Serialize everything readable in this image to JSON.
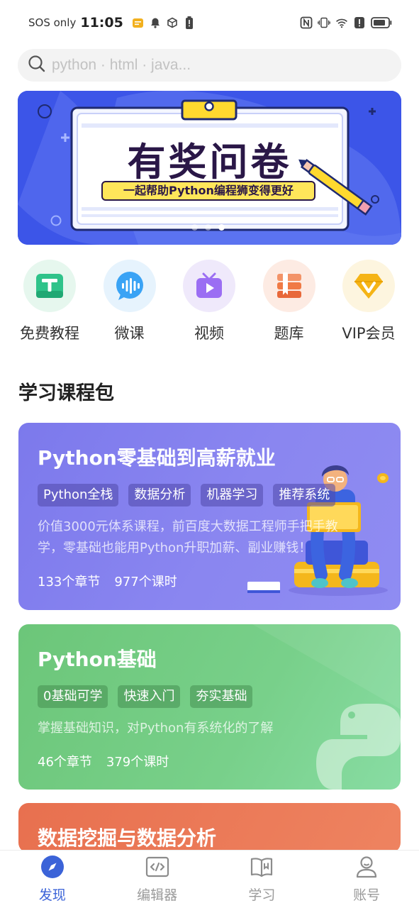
{
  "status_bar": {
    "carrier": "SOS only",
    "time": "11:05",
    "left_icons": [
      "notes-icon",
      "bell-icon",
      "box-icon",
      "battery-alert-icon"
    ],
    "right_icons": [
      "nfc-icon",
      "vibrate-icon",
      "wifi-icon",
      "alert-icon",
      "battery-icon"
    ]
  },
  "search": {
    "placeholder": "python · html · java..."
  },
  "banner": {
    "title": "有奖问卷",
    "subtitle": "一起帮助Python编程狮变得更好",
    "active_slide": 3,
    "slide_count": 3
  },
  "categories": [
    {
      "label": "免费教程",
      "icon": "book-t-icon",
      "color": "#2fc38a",
      "bg": "#e6f7ee"
    },
    {
      "label": "微课",
      "icon": "audio-bubble-icon",
      "color": "#3aa3f5",
      "bg": "#e6f3fd"
    },
    {
      "label": "视频",
      "icon": "tv-play-icon",
      "color": "#9b6ef3",
      "bg": "#efe9fb"
    },
    {
      "label": "题库",
      "icon": "books-icon",
      "color": "#f07a45",
      "bg": "#fdebe3"
    },
    {
      "label": "VIP会员",
      "icon": "diamond-v-icon",
      "color": "#f5b416",
      "bg": "#fdf5df"
    }
  ],
  "section_title": "学习课程包",
  "courses": [
    {
      "title": "Python零基础到高薪就业",
      "tags": [
        "Python全栈",
        "数据分析",
        "机器学习",
        "推荐系统"
      ],
      "desc_line1": "价值3000元体系课程，前百度大数据工程师手把手教",
      "desc_line2": "学，零基础也能用Python升职加薪、副业赚钱！",
      "chapters": "133个章节",
      "lessons": "977个课时"
    },
    {
      "title": "Python基础",
      "tags": [
        "0基础可学",
        "快速入门",
        "夯实基础"
      ],
      "desc_line1": "掌握基础知识，对Python有系统化的了解",
      "chapters": "46个章节",
      "lessons": "379个课时"
    },
    {
      "title": "数据挖掘与数据分析"
    }
  ],
  "bottom_nav": [
    {
      "label": "发现",
      "icon": "compass-icon",
      "active": true
    },
    {
      "label": "编辑器",
      "icon": "code-editor-icon",
      "active": false
    },
    {
      "label": "学习",
      "icon": "open-book-icon",
      "active": false
    },
    {
      "label": "账号",
      "icon": "user-icon",
      "active": false
    }
  ],
  "colors": {
    "accent": "#3b63d8",
    "card1": "#8582ee",
    "card2": "#74cd86",
    "card3": "#e8704f"
  }
}
